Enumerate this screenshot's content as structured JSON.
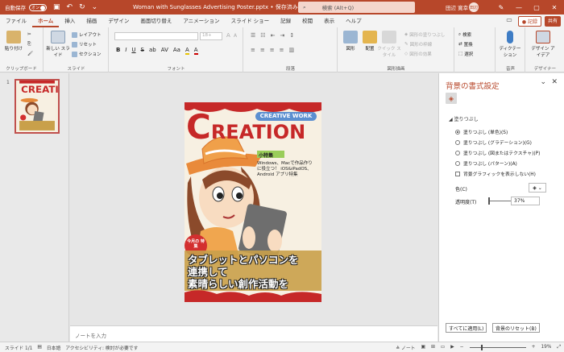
{
  "titlebar": {
    "autosave_label": "自動保存",
    "autosave_state": "オン",
    "file_title": "Woman with Sunglasses Advertising Poster.pptx • 保存済み ⌄",
    "search_placeholder": "検索 (Alt+Q)",
    "user_name": "田辺 寛幸",
    "user_initials": "田辺"
  },
  "tabs": [
    {
      "label": "ファイル"
    },
    {
      "label": "ホーム"
    },
    {
      "label": "挿入"
    },
    {
      "label": "描画"
    },
    {
      "label": "デザイン"
    },
    {
      "label": "画面切り替え"
    },
    {
      "label": "アニメーション"
    },
    {
      "label": "スライド ショー"
    },
    {
      "label": "記録"
    },
    {
      "label": "校閲"
    },
    {
      "label": "表示"
    },
    {
      "label": "ヘルプ"
    }
  ],
  "tab_buttons": {
    "record": "● 記録",
    "share": "共有"
  },
  "ribbon": {
    "clipboard": {
      "paste": "貼り付け",
      "label": "クリップボード"
    },
    "slides": {
      "new_slide": "新しい スライド",
      "layout": "レイアウト",
      "reset": "リセット",
      "section": "セクション",
      "label": "スライド"
    },
    "font": {
      "font_size": "18+",
      "label": "フォント",
      "format_glyphs": [
        "B",
        "I",
        "U",
        "S",
        "ab",
        "AV",
        "Aa",
        "A",
        "A"
      ]
    },
    "paragraph": {
      "label": "段落"
    },
    "drawing": {
      "shapes": "図形",
      "arrange": "配置",
      "quick_styles": "クイック スタイル",
      "fill": "図形の塗りつぶし",
      "outline": "図形の枠線",
      "effects": "図形の効果",
      "label": "図形描画"
    },
    "editing": {
      "find": "検索",
      "replace": "置換",
      "select": "選択"
    },
    "voice": {
      "dictate": "ディクテーション",
      "label": "音声"
    },
    "designer": {
      "design_ideas": "デザイン アイデア",
      "label": "デザイナー"
    }
  },
  "thumbnail": {
    "number": "1"
  },
  "slide": {
    "banner": "CREATIVE WORK",
    "title_c": "C",
    "title_rest": "REATION",
    "feature_heading": "小特集",
    "feature_body": "Windows、Macで作品作りに役立つ！ iOS&iPadOS、Android アプリ特集",
    "badge": "今月の 特集",
    "headline_lines": [
      "タブレットとパソコンを",
      "連携して",
      "素晴らしい創作活動を"
    ]
  },
  "notes": {
    "placeholder": "ノートを入力"
  },
  "format_pane": {
    "title": "背景の書式設定",
    "section": "◢ 塗りつぶし",
    "options": [
      {
        "label": "塗りつぶし (単色)(S)",
        "selected": true
      },
      {
        "label": "塗りつぶし (グラデーション)(G)",
        "selected": false
      },
      {
        "label": "塗りつぶし (図またはテクスチャ)(P)",
        "selected": false
      },
      {
        "label": "塗りつぶし (パターン)(A)",
        "selected": false
      }
    ],
    "hide_graphics": "背景グラフィックを表示しない(H)",
    "color_label": "色(C)",
    "transparency_label": "透明度(T)",
    "transparency_value": "37%",
    "transparency_fraction": 0.37,
    "apply_all": "すべてに適用(L)",
    "reset_bg": "背景のリセット(B)"
  },
  "statusbar": {
    "slide_info": "スライド 1/1",
    "language": "日本語",
    "accessibility": "アクセシビリティ: 検討が必要です",
    "notes_btn": "≙ ノート",
    "zoom": "19%"
  },
  "colors": {
    "accent": "#b7472a",
    "slide_red": "#c62828",
    "slide_blue": "#5b8fd0"
  }
}
